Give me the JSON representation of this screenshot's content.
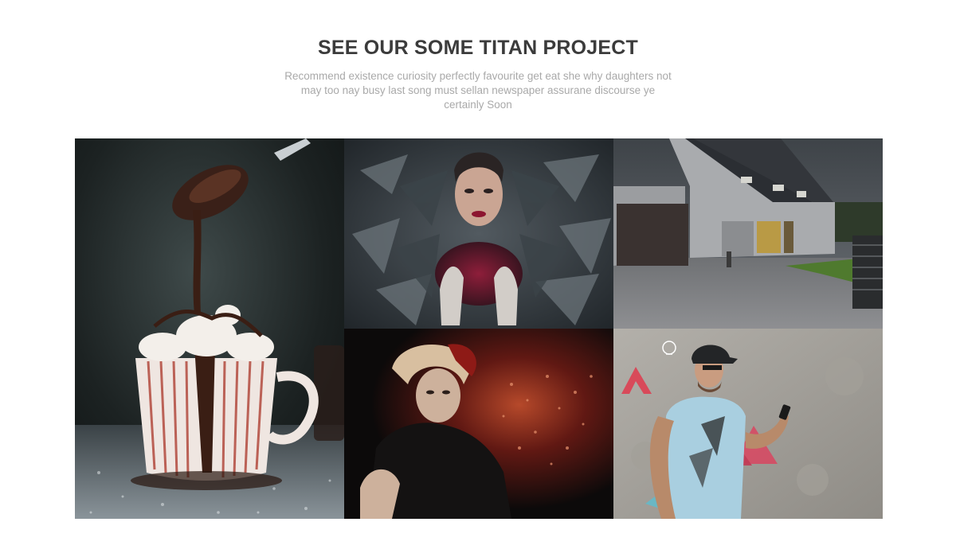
{
  "section": {
    "title": "SEE OUR SOME TITAN PROJECT",
    "description": "Recommend existence curiosity perfectly favourite get eat she why daughters not may too nay busy last song must sellan newspaper assurane discourse ye certainly Soon"
  },
  "projects": [
    {
      "subject": "hot chocolate cup with spoon"
    },
    {
      "subject": "woman with feather collar"
    },
    {
      "subject": "modern house with garage"
    },
    {
      "subject": "woman with red particle effect"
    },
    {
      "subject": "man in cap with phone and graphic overlay"
    }
  ]
}
